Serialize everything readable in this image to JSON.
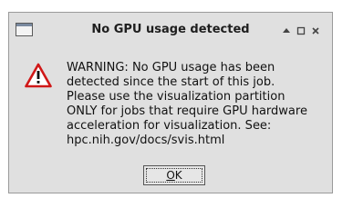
{
  "window": {
    "title": "No GPU usage detected",
    "controls": [
      {
        "name": "maximize-up",
        "icon": "arrow-up-icon"
      },
      {
        "name": "restore",
        "icon": "square-icon"
      },
      {
        "name": "close",
        "icon": "close-icon"
      }
    ]
  },
  "dialog": {
    "icon": "warning-triangle-icon",
    "message": "WARNING: No GPU usage has been\ndetected since the start of this job.\nPlease use the visualization partition\nONLY for jobs that require GPU hardware\nacceleration for visualization. See:\nhpc.nih.gov/docs/svis.html",
    "ok_mnemonic": "O",
    "ok_rest": "K"
  },
  "colors": {
    "window_bg": "#e0e0e0",
    "warning_red": "#d01818"
  }
}
